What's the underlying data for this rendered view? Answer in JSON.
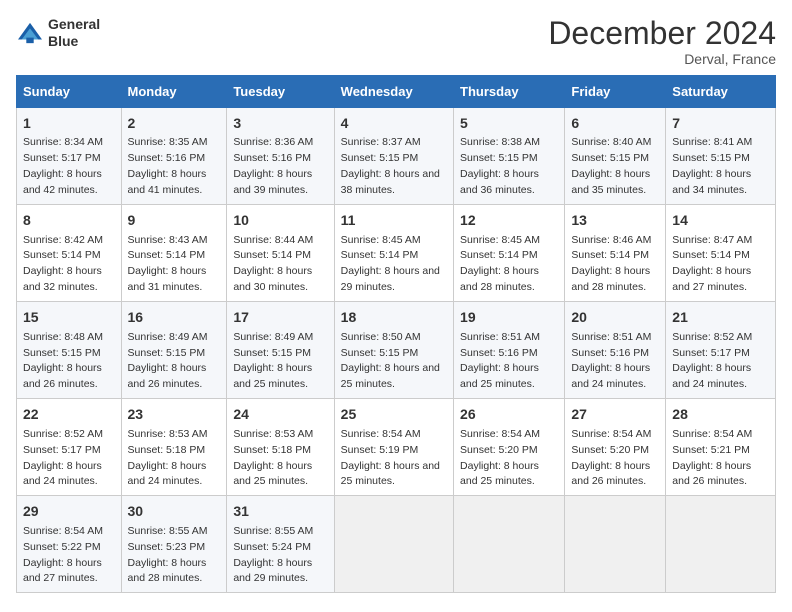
{
  "header": {
    "logo_line1": "General",
    "logo_line2": "Blue",
    "month": "December 2024",
    "location": "Derval, France"
  },
  "days_of_week": [
    "Sunday",
    "Monday",
    "Tuesday",
    "Wednesday",
    "Thursday",
    "Friday",
    "Saturday"
  ],
  "weeks": [
    [
      {
        "day": 1,
        "sunrise": "8:34 AM",
        "sunset": "5:17 PM",
        "daylight": "8 hours and 42 minutes."
      },
      {
        "day": 2,
        "sunrise": "8:35 AM",
        "sunset": "5:16 PM",
        "daylight": "8 hours and 41 minutes."
      },
      {
        "day": 3,
        "sunrise": "8:36 AM",
        "sunset": "5:16 PM",
        "daylight": "8 hours and 39 minutes."
      },
      {
        "day": 4,
        "sunrise": "8:37 AM",
        "sunset": "5:15 PM",
        "daylight": "8 hours and 38 minutes."
      },
      {
        "day": 5,
        "sunrise": "8:38 AM",
        "sunset": "5:15 PM",
        "daylight": "8 hours and 36 minutes."
      },
      {
        "day": 6,
        "sunrise": "8:40 AM",
        "sunset": "5:15 PM",
        "daylight": "8 hours and 35 minutes."
      },
      {
        "day": 7,
        "sunrise": "8:41 AM",
        "sunset": "5:15 PM",
        "daylight": "8 hours and 34 minutes."
      }
    ],
    [
      {
        "day": 8,
        "sunrise": "8:42 AM",
        "sunset": "5:14 PM",
        "daylight": "8 hours and 32 minutes."
      },
      {
        "day": 9,
        "sunrise": "8:43 AM",
        "sunset": "5:14 PM",
        "daylight": "8 hours and 31 minutes."
      },
      {
        "day": 10,
        "sunrise": "8:44 AM",
        "sunset": "5:14 PM",
        "daylight": "8 hours and 30 minutes."
      },
      {
        "day": 11,
        "sunrise": "8:45 AM",
        "sunset": "5:14 PM",
        "daylight": "8 hours and 29 minutes."
      },
      {
        "day": 12,
        "sunrise": "8:45 AM",
        "sunset": "5:14 PM",
        "daylight": "8 hours and 28 minutes."
      },
      {
        "day": 13,
        "sunrise": "8:46 AM",
        "sunset": "5:14 PM",
        "daylight": "8 hours and 28 minutes."
      },
      {
        "day": 14,
        "sunrise": "8:47 AM",
        "sunset": "5:14 PM",
        "daylight": "8 hours and 27 minutes."
      }
    ],
    [
      {
        "day": 15,
        "sunrise": "8:48 AM",
        "sunset": "5:15 PM",
        "daylight": "8 hours and 26 minutes."
      },
      {
        "day": 16,
        "sunrise": "8:49 AM",
        "sunset": "5:15 PM",
        "daylight": "8 hours and 26 minutes."
      },
      {
        "day": 17,
        "sunrise": "8:49 AM",
        "sunset": "5:15 PM",
        "daylight": "8 hours and 25 minutes."
      },
      {
        "day": 18,
        "sunrise": "8:50 AM",
        "sunset": "5:15 PM",
        "daylight": "8 hours and 25 minutes."
      },
      {
        "day": 19,
        "sunrise": "8:51 AM",
        "sunset": "5:16 PM",
        "daylight": "8 hours and 25 minutes."
      },
      {
        "day": 20,
        "sunrise": "8:51 AM",
        "sunset": "5:16 PM",
        "daylight": "8 hours and 24 minutes."
      },
      {
        "day": 21,
        "sunrise": "8:52 AM",
        "sunset": "5:17 PM",
        "daylight": "8 hours and 24 minutes."
      }
    ],
    [
      {
        "day": 22,
        "sunrise": "8:52 AM",
        "sunset": "5:17 PM",
        "daylight": "8 hours and 24 minutes."
      },
      {
        "day": 23,
        "sunrise": "8:53 AM",
        "sunset": "5:18 PM",
        "daylight": "8 hours and 24 minutes."
      },
      {
        "day": 24,
        "sunrise": "8:53 AM",
        "sunset": "5:18 PM",
        "daylight": "8 hours and 25 minutes."
      },
      {
        "day": 25,
        "sunrise": "8:54 AM",
        "sunset": "5:19 PM",
        "daylight": "8 hours and 25 minutes."
      },
      {
        "day": 26,
        "sunrise": "8:54 AM",
        "sunset": "5:20 PM",
        "daylight": "8 hours and 25 minutes."
      },
      {
        "day": 27,
        "sunrise": "8:54 AM",
        "sunset": "5:20 PM",
        "daylight": "8 hours and 26 minutes."
      },
      {
        "day": 28,
        "sunrise": "8:54 AM",
        "sunset": "5:21 PM",
        "daylight": "8 hours and 26 minutes."
      }
    ],
    [
      {
        "day": 29,
        "sunrise": "8:54 AM",
        "sunset": "5:22 PM",
        "daylight": "8 hours and 27 minutes."
      },
      {
        "day": 30,
        "sunrise": "8:55 AM",
        "sunset": "5:23 PM",
        "daylight": "8 hours and 28 minutes."
      },
      {
        "day": 31,
        "sunrise": "8:55 AM",
        "sunset": "5:24 PM",
        "daylight": "8 hours and 29 minutes."
      },
      null,
      null,
      null,
      null
    ]
  ]
}
